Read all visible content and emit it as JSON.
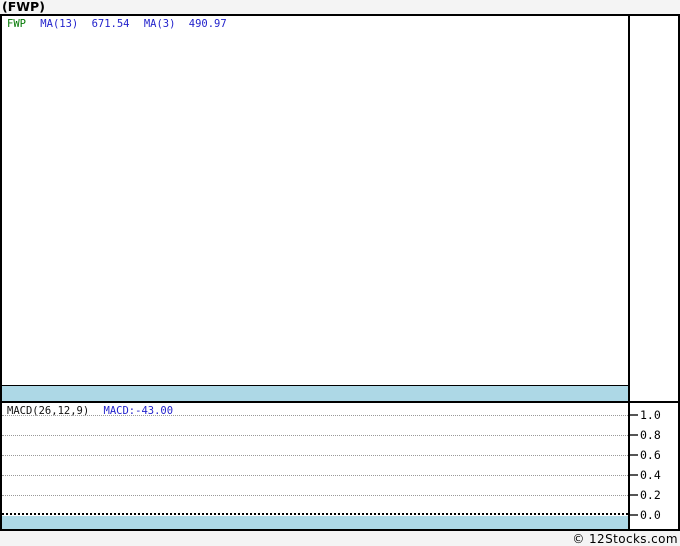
{
  "title": "(FWP)",
  "main_chart": {
    "legend": {
      "symbol": "FWP",
      "ma13_label": "MA(13)",
      "ma13_value": "671.54",
      "ma3_label": "MA(3)",
      "ma3_value": "490.97"
    }
  },
  "macd_panel": {
    "label": "MACD(26,12,9)",
    "value_label": "MACD:-43.00",
    "axis_ticks": [
      "1.0",
      "0.8",
      "0.6",
      "0.4",
      "0.2",
      "0.0"
    ]
  },
  "footer": {
    "copyright": "© 12Stocks.com"
  },
  "colors": {
    "band_blue": "#ADD8E6",
    "legend_green": "#007700",
    "legend_blue": "#2323CC",
    "grid_gray": "#999999",
    "border_black": "#000000",
    "page_background": "#F4F4F4",
    "plot_background": "#FFFFFF"
  },
  "chart_data": [
    {
      "type": "line",
      "panel": "price",
      "title": "(FWP)",
      "series": [
        {
          "name": "FWP",
          "color": "#007700",
          "visible_points": []
        },
        {
          "name": "MA(13)",
          "color": "#2323CC",
          "last_value": 671.54
        },
        {
          "name": "MA(3)",
          "color": "#2323CC",
          "last_value": 490.97
        }
      ],
      "x_axis": {
        "labels_visible": false
      },
      "y_axis": {
        "labels_visible": false
      },
      "annotations": [
        "flat light-blue band with black top edge along bottom of panel; rest of panel empty/white"
      ]
    },
    {
      "type": "line",
      "panel": "indicator",
      "title": "MACD(26,12,9)",
      "series": [
        {
          "name": "MACD",
          "last_value": -43.0
        }
      ],
      "y_axis": {
        "side": "right",
        "range": [
          0.0,
          1.0
        ],
        "ticks": [
          1.0,
          0.8,
          0.6,
          0.4,
          0.2,
          0.0
        ]
      },
      "grid": {
        "horizontal_dotted": true,
        "zero_line_emphasized": true
      },
      "annotations": [
        "flat light-blue band along bottom of panel below emphasized dotted 0.0 line"
      ]
    }
  ]
}
